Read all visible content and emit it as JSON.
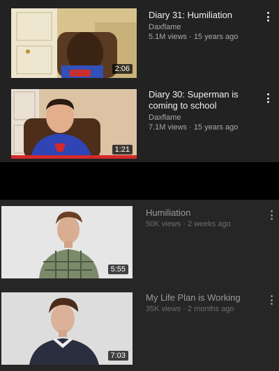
{
  "videos": [
    {
      "title": "Diary 31: Humiliation",
      "channel": "Daxflame",
      "views": "5.1M views",
      "age": "15 years ago",
      "duration": "2:06",
      "thumb_icon": "person-in-chair-thumbnail"
    },
    {
      "title": "Diary 30: Superman is coming to school",
      "channel": "Daxflame",
      "views": "7.1M views",
      "age": "15 years ago",
      "duration": "1:21",
      "thumb_icon": "superman-shirt-thumbnail"
    },
    {
      "title": "Humiliation",
      "channel": "",
      "views": "50K views",
      "age": "2 weeks ago",
      "duration": "5:55",
      "thumb_icon": "man-plaid-shirt-thumbnail"
    },
    {
      "title": "My Life Plan is Working",
      "channel": "",
      "views": "35K views",
      "age": "2 months ago",
      "duration": "7:03",
      "thumb_icon": "man-dark-shirt-thumbnail"
    }
  ],
  "colors": {
    "top_bg": "#222222",
    "bottom_bg": "#262626",
    "divider": "#000000",
    "text_primary": "#f1f1f1",
    "text_secondary": "#aaaaaa"
  }
}
